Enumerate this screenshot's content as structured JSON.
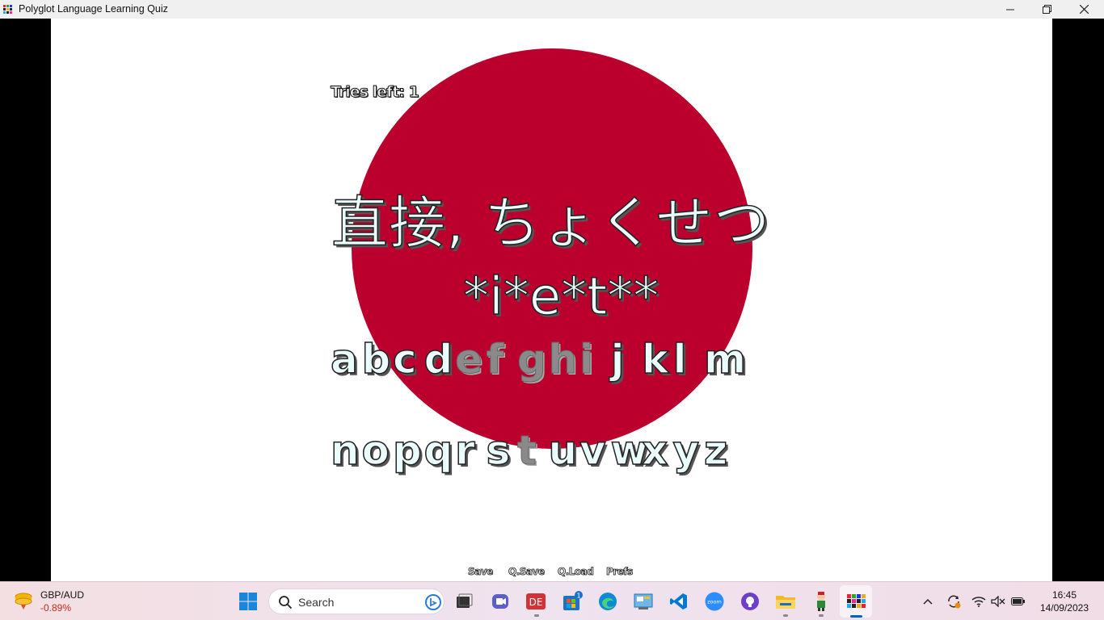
{
  "window": {
    "title": "Polyglot Language Learning Quiz",
    "icon": "app-grid-icon",
    "controls": [
      "minimize-icon",
      "restore-icon",
      "close-icon"
    ]
  },
  "game": {
    "tries_label": "Tries left: 1",
    "prompt": "直接, ちょくせつ",
    "masked_answer": "*i*e*t**",
    "flag_color": "#bc002d",
    "alphabet_row1": [
      {
        "letter": "a",
        "used": false
      },
      {
        "letter": "b",
        "used": false
      },
      {
        "letter": "c",
        "used": false
      },
      {
        "letter": "d",
        "used": false
      },
      {
        "letter": "e",
        "used": true
      },
      {
        "letter": "f",
        "used": true
      },
      {
        "letter": "g",
        "used": true
      },
      {
        "letter": "h",
        "used": true
      },
      {
        "letter": "i",
        "used": true
      },
      {
        "letter": "j",
        "used": false
      },
      {
        "letter": "k",
        "used": false
      },
      {
        "letter": "l",
        "used": false
      },
      {
        "letter": "m",
        "used": false
      }
    ],
    "alphabet_row2": [
      {
        "letter": "n",
        "used": false
      },
      {
        "letter": "o",
        "used": false
      },
      {
        "letter": "p",
        "used": false
      },
      {
        "letter": "q",
        "used": false
      },
      {
        "letter": "r",
        "used": false
      },
      {
        "letter": "s",
        "used": false
      },
      {
        "letter": "t",
        "used": true
      },
      {
        "letter": "u",
        "used": false
      },
      {
        "letter": "v",
        "used": false
      },
      {
        "letter": "w",
        "used": false
      },
      {
        "letter": "x",
        "used": false
      },
      {
        "letter": "y",
        "used": false
      },
      {
        "letter": "z",
        "used": false
      }
    ],
    "menu": {
      "save": "Save",
      "qsave": "Q.Save",
      "qload": "Q.Load",
      "prefs": "Prefs"
    }
  },
  "taskbar": {
    "widget": {
      "title": "GBP/AUD",
      "change": "-0.89%"
    },
    "search_placeholder": "Search",
    "pinned": [
      "start-icon",
      "task-view-icon",
      "teams-meet-icon",
      "office-app-icon",
      "microsoft-store-icon",
      "edge-icon",
      "control-panel-icon",
      "vscode-icon",
      "zoom-icon",
      "github-icon",
      "file-explorer-icon",
      "game-mascot-icon",
      "polyglot-app-icon"
    ],
    "store_badge": "1",
    "zoom_label": "zoom",
    "tray": [
      "chevron-up-icon",
      "sync-icon",
      "wifi-icon",
      "volume-muted-icon",
      "battery-icon"
    ],
    "time": "16:45",
    "date": "14/09/2023"
  }
}
